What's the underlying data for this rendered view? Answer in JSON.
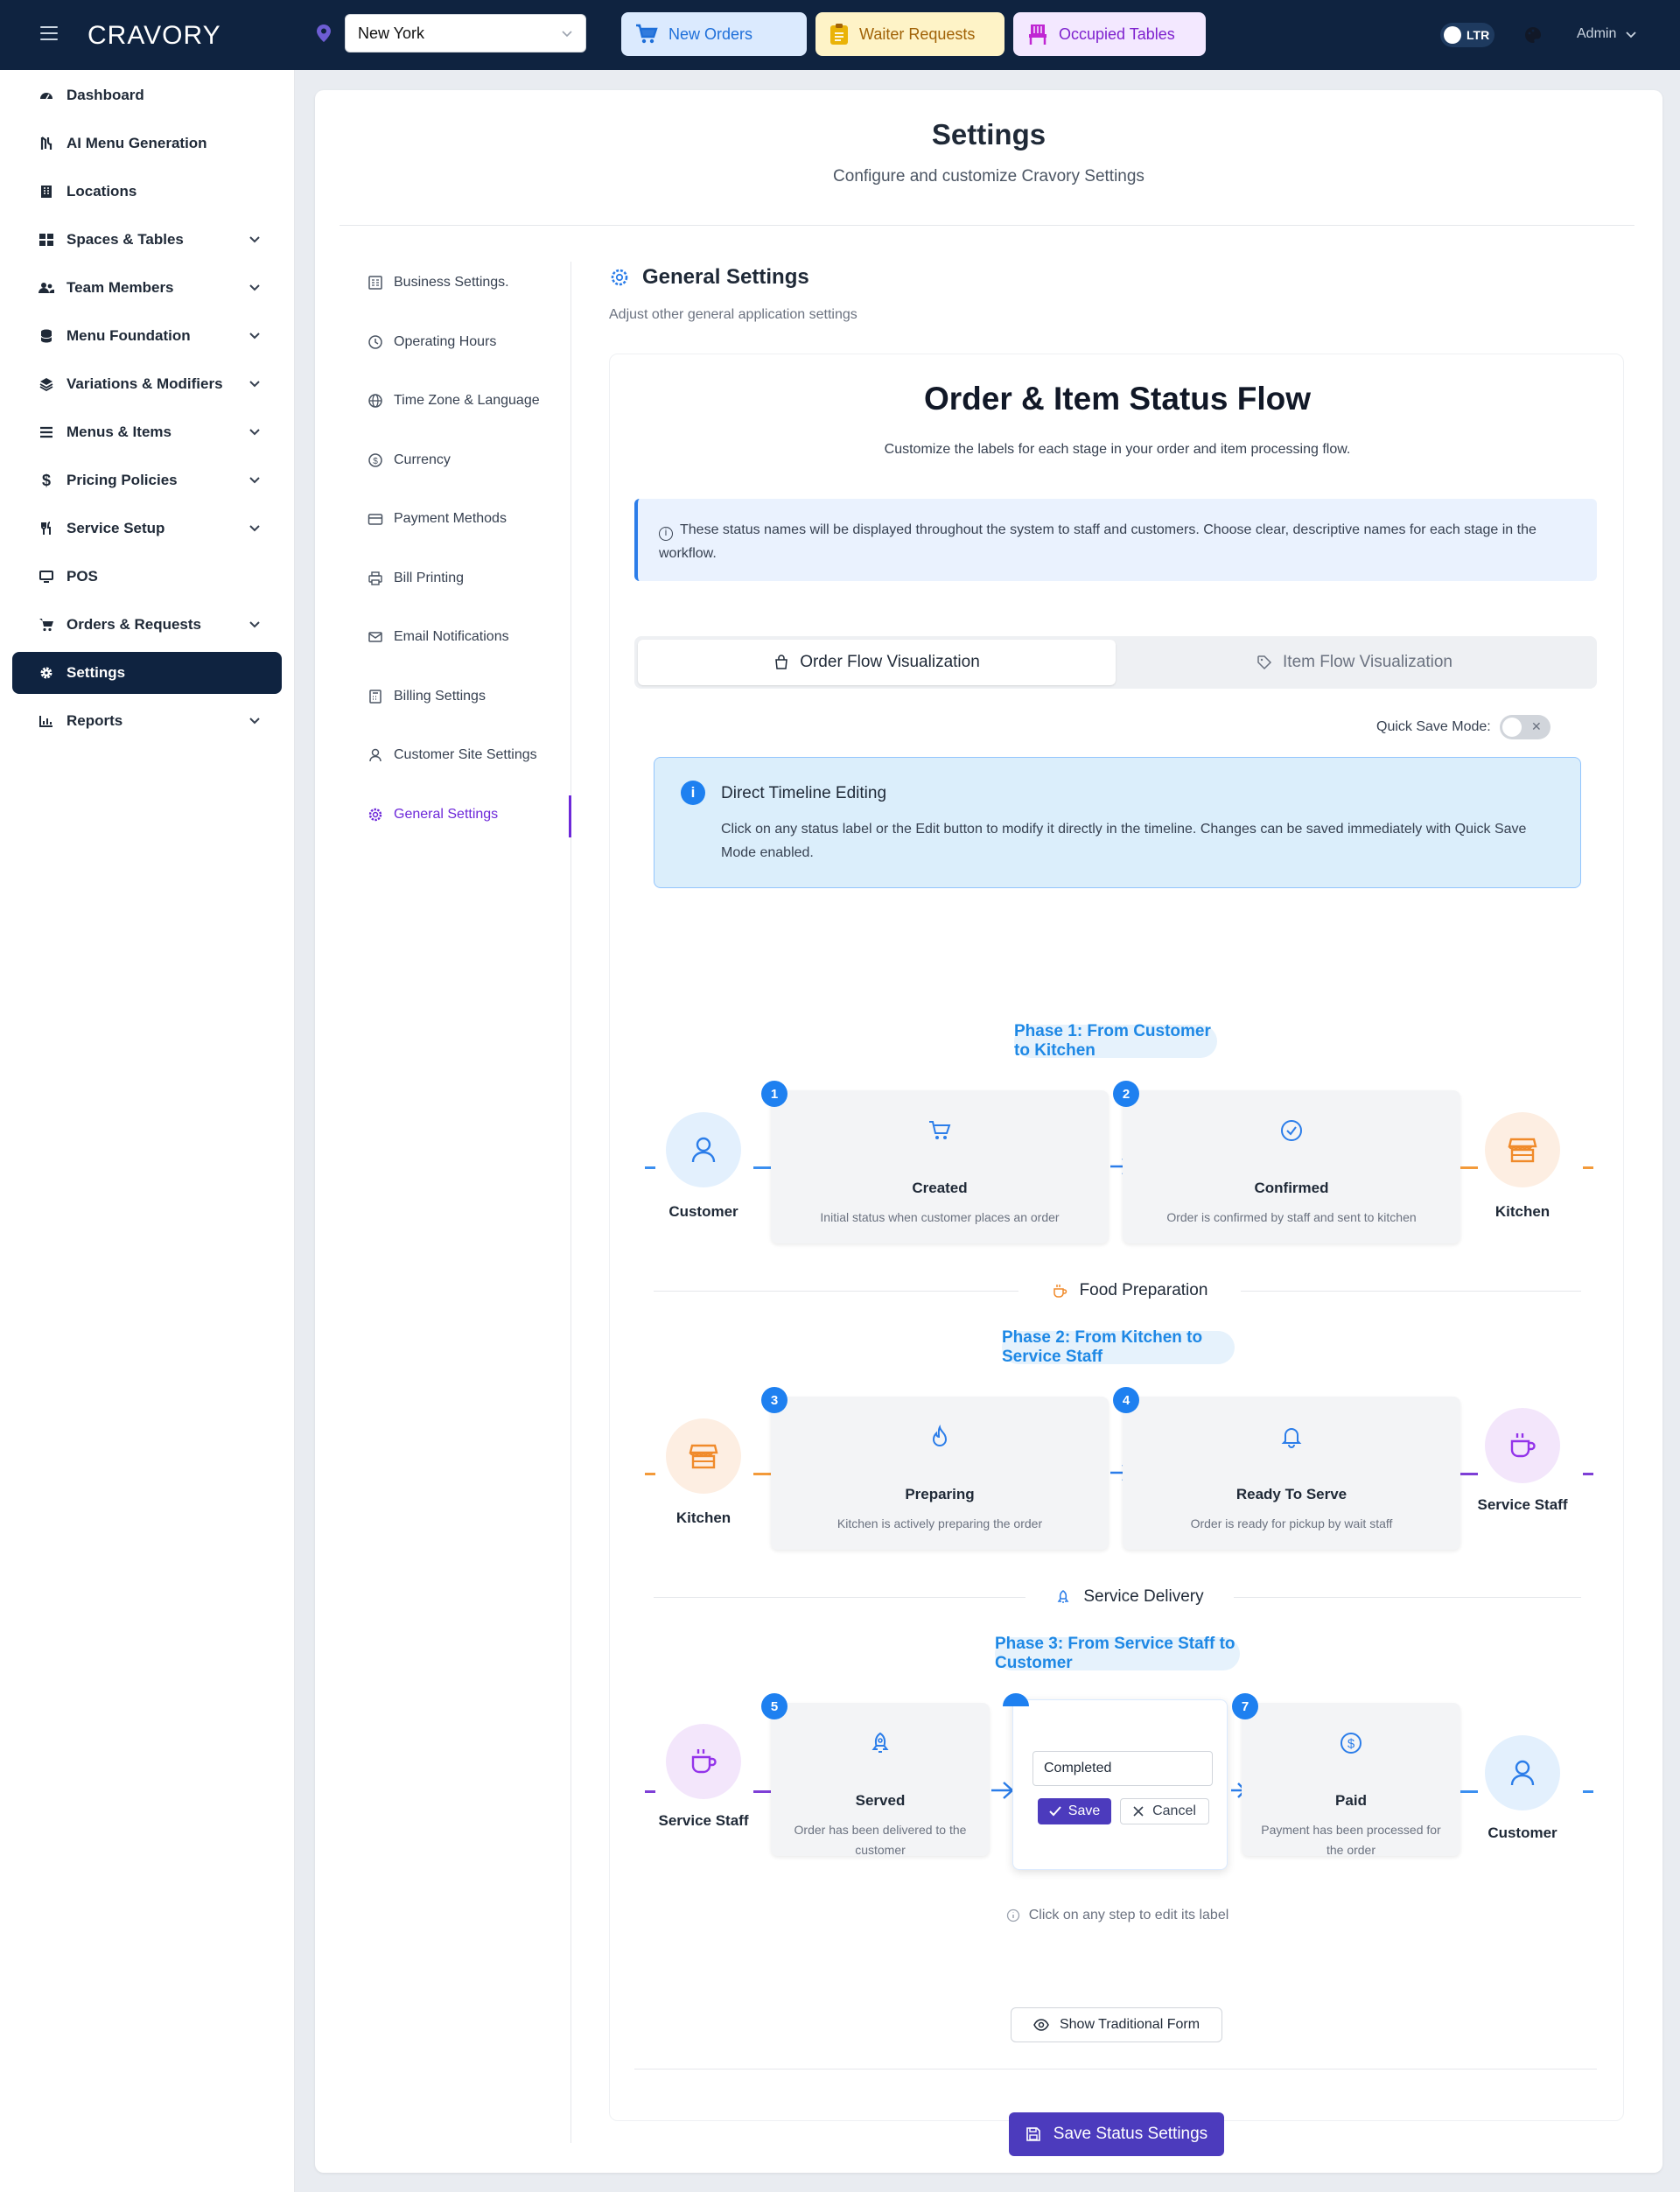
{
  "topbar": {
    "logo": "CRAVORY",
    "location": "New York",
    "buttons": {
      "new_orders": "New Orders",
      "waiter_requests": "Waiter Requests",
      "occupied_tables": "Occupied Tables"
    },
    "ltr": "LTR",
    "user": "Admin"
  },
  "sidebar": {
    "items": [
      {
        "label": "Dashboard",
        "icon": "dashboard-icon"
      },
      {
        "label": "AI Menu Generation",
        "icon": "ai-icon"
      },
      {
        "label": "Locations",
        "icon": "building-icon"
      },
      {
        "label": "Spaces & Tables",
        "icon": "grid-icon"
      },
      {
        "label": "Team Members",
        "icon": "users-icon"
      },
      {
        "label": "Menu Foundation",
        "icon": "database-icon"
      },
      {
        "label": "Variations & Modifiers",
        "icon": "layers-icon"
      },
      {
        "label": "Menus & Items",
        "icon": "list-icon"
      },
      {
        "label": "Pricing Policies",
        "icon": "dollar-icon"
      },
      {
        "label": "Service Setup",
        "icon": "utensils-icon"
      },
      {
        "label": "POS",
        "icon": "monitor-icon"
      },
      {
        "label": "Orders & Requests",
        "icon": "cart-icon"
      },
      {
        "label": "Settings",
        "icon": "gear-icon"
      },
      {
        "label": "Reports",
        "icon": "chart-icon"
      }
    ]
  },
  "page": {
    "title": "Settings",
    "subtitle": "Configure and customize Cravory Settings"
  },
  "settings_nav": [
    {
      "label": "Business Settings."
    },
    {
      "label": "Operating Hours"
    },
    {
      "label": "Time Zone & Language"
    },
    {
      "label": "Currency"
    },
    {
      "label": "Payment Methods"
    },
    {
      "label": "Bill Printing"
    },
    {
      "label": "Email Notifications"
    },
    {
      "label": "Billing Settings"
    },
    {
      "label": "Customer Site Settings"
    },
    {
      "label": "General Settings"
    }
  ],
  "general": {
    "title": "General Settings",
    "subtitle": "Adjust other general application settings"
  },
  "flow": {
    "title": "Order & Item Status Flow",
    "subtitle": "Customize the labels for each stage in your order and item processing flow.",
    "info": "These status names will be displayed throughout the system to staff and customers. Choose clear, descriptive names for each stage in the workflow.",
    "tabs": [
      "Order Flow Visualization",
      "Item Flow Visualization"
    ],
    "quick_save_label": "Quick Save Mode:",
    "direct_title": "Direct Timeline Editing",
    "direct_text": "Click on any status label or the Edit button to modify it directly in the timeline. Changes can be saved immediately with Quick Save Mode enabled.",
    "phases": [
      {
        "title": "Phase 1: From Customer to Kitchen",
        "start": "Customer",
        "end": "Kitchen"
      },
      {
        "title": "Phase 2: From Kitchen to Service Staff",
        "start": "Kitchen",
        "end": "Service Staff"
      },
      {
        "title": "Phase 3: From Service Staff to Customer",
        "start": "Service Staff",
        "end": "Customer"
      }
    ],
    "dividers": [
      "Food Preparation",
      "Service Delivery"
    ],
    "steps": [
      {
        "num": "1",
        "title": "Created",
        "desc": "Initial status when customer places an order"
      },
      {
        "num": "2",
        "title": "Confirmed",
        "desc": "Order is confirmed by staff and sent to kitchen"
      },
      {
        "num": "3",
        "title": "Preparing",
        "desc": "Kitchen is actively preparing the order"
      },
      {
        "num": "4",
        "title": "Ready To Serve",
        "desc": "Order is ready for pickup by wait staff"
      },
      {
        "num": "5",
        "title": "Served",
        "desc": "Order has been delivered to the customer"
      },
      {
        "num": "7",
        "title": "Paid",
        "desc": "Payment has been processed for the order"
      }
    ],
    "edit": {
      "value": "Completed",
      "save": "Save",
      "cancel": "Cancel"
    },
    "hint": "Click on any step to edit its label",
    "show_form": "Show Traditional Form",
    "save_button": "Save Status Settings"
  }
}
